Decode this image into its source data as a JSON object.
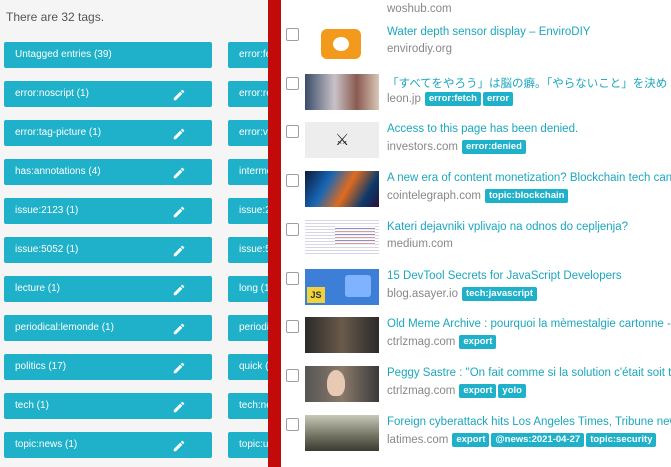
{
  "left": {
    "count_text": "There are 32 tags.",
    "tags_col1": [
      "Untagged entries (39)",
      "error:noscript (1)",
      "error:tag-picture (1)",
      "has:annotations (4)",
      "issue:2123 (1)",
      "issue:5052 (1)",
      "lecture (1)",
      "periodical:lemonde (1)",
      "politics (17)",
      "tech (1)",
      "topic:news (1)"
    ],
    "tags_col2": [
      "error:fe",
      "error:re",
      "error:vi",
      "interme",
      "issue:2",
      "issue:5",
      "long (1",
      "periodi",
      "quick (",
      "tech:ne",
      "topic:u"
    ],
    "edit_icon": "pencil-icon"
  },
  "colors": {
    "accent": "#1eb1c9",
    "divider": "#c20a0a",
    "link": "#1ba7bf",
    "muted": "#888888"
  },
  "entries": [
    {
      "title": "",
      "domain": "woshub.com",
      "tags": []
    },
    {
      "title": "Water depth sensor display – EnviroDIY",
      "domain": "envirodiy.org",
      "tags": []
    },
    {
      "title": "「すべてをやろう」は脳の癖。「やらないこと」を決め",
      "domain": "leon.jp",
      "tags": [
        "error:fetch",
        "error"
      ]
    },
    {
      "title": "Access to this page has been denied.",
      "domain": "investors.com",
      "tags": [
        "error:denied"
      ]
    },
    {
      "title": "A new era of content monetization? Blockchain tech can c",
      "domain": "cointelegraph.com",
      "tags": [
        "topic:blockchain"
      ]
    },
    {
      "title": "Kateri dejavniki vplivajo na odnos do cepljenja?",
      "domain": "medium.com",
      "tags": []
    },
    {
      "title": "15 DevTool Secrets for JavaScript Developers",
      "domain": "blog.asayer.io",
      "tags": [
        "tech:javascript"
      ]
    },
    {
      "title": "Old Meme Archive : pourquoi la mèmestalgie cartonne - C",
      "domain": "ctrlzmag.com",
      "tags": [
        "export"
      ]
    },
    {
      "title": "Peggy Sastre : \"On fait comme si la solution c'était soit tu",
      "domain": "ctrlzmag.com",
      "tags": [
        "export",
        "yolo"
      ]
    },
    {
      "title": "Foreign cyberattack hits Los Angeles Times, Tribune new",
      "domain": "latimes.com",
      "tags": [
        "export",
        "@news:2021-04-27",
        "topic:security"
      ]
    }
  ]
}
